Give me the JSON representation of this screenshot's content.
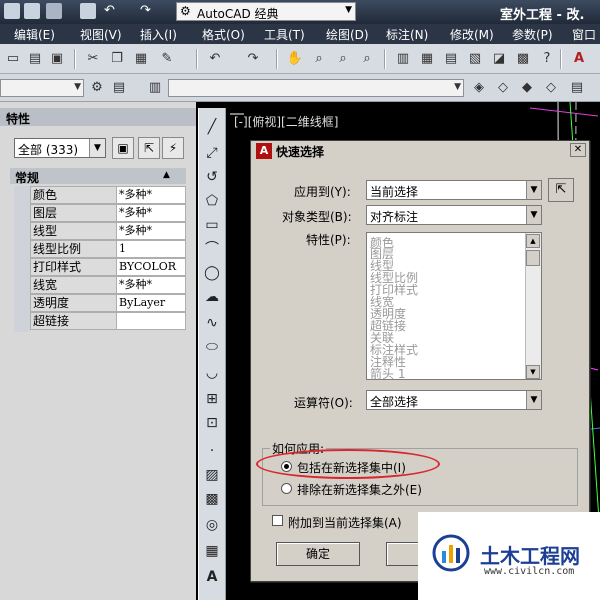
{
  "title_bar": {
    "workspace": "AutoCAD 经典",
    "app_title": "室外工程 - 改."
  },
  "menu": [
    "编辑(E)",
    "视图(V)",
    "插入(I)",
    "格式(O)",
    "工具(T)",
    "绘图(D)",
    "标注(N)",
    "修改(M)",
    "参数(P)",
    "窗口"
  ],
  "properties_palette": {
    "title": "特性",
    "selection": "全部 (333)",
    "category": "常规",
    "rows": [
      {
        "label": "颜色",
        "value": "*多种*"
      },
      {
        "label": "图层",
        "value": "*多种*"
      },
      {
        "label": "线型",
        "value": "*多种*"
      },
      {
        "label": "线型比例",
        "value": "1"
      },
      {
        "label": "打印样式",
        "value": "BYCOLOR"
      },
      {
        "label": "线宽",
        "value": "*多种*"
      },
      {
        "label": "透明度",
        "value": "ByLayer"
      },
      {
        "label": "超链接",
        "value": ""
      }
    ]
  },
  "viewport_label": "[-][俯视][二维线框]",
  "dialog": {
    "title": "快速选择",
    "apply_to_label": "应用到(Y):",
    "apply_to_value": "当前选择",
    "object_type_label": "对象类型(B):",
    "object_type_value": "对齐标注",
    "properties_label": "特性(P):",
    "properties_list": [
      "颜色",
      "图层",
      "线型",
      "线型比例",
      "打印样式",
      "线宽",
      "透明度",
      "超链接",
      "关联",
      "标注样式",
      "注释性",
      "箭头 1"
    ],
    "operator_label": "运算符(O):",
    "operator_value": "全部选择",
    "how_to_apply": "如何应用:",
    "radio_include": "包括在新选择集中(I)",
    "radio_exclude": "排除在新选择集之外(E)",
    "append_checkbox": "附加到当前选择集(A)",
    "ok_button": "确定",
    "cancel_button": "取"
  },
  "watermark": {
    "name": "土木工程网",
    "url": "www.civilcn.com"
  },
  "colors": {
    "highlight_ellipse": "#d8272e",
    "dialog_face": "#d4d0c8",
    "watermark_blue": "#1c3f94"
  }
}
